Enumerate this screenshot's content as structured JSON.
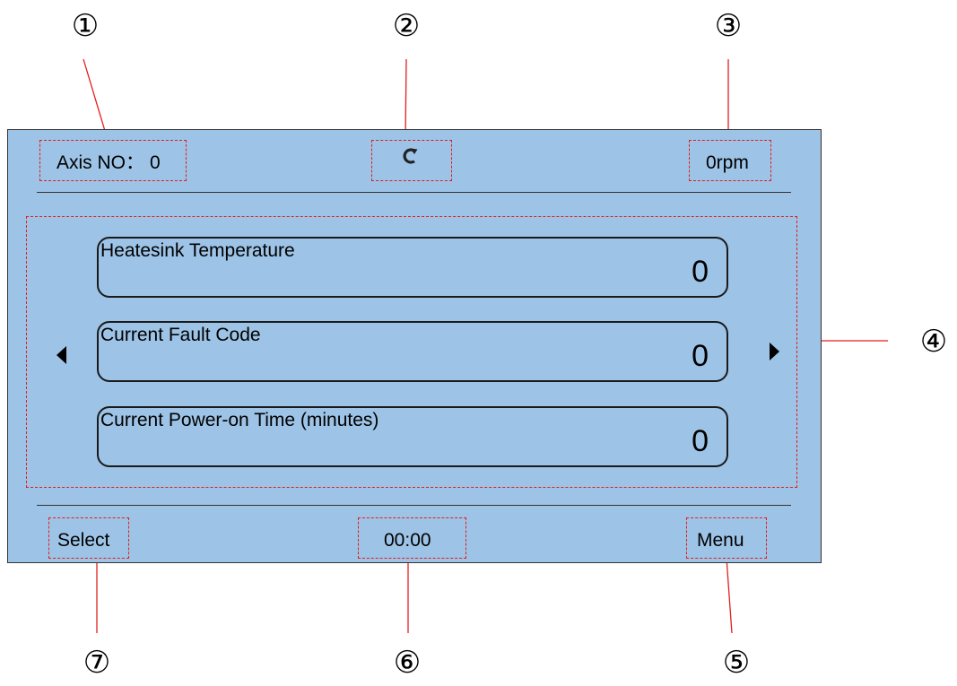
{
  "callouts": {
    "c1": "①",
    "c2": "②",
    "c3": "③",
    "c4": "④",
    "c5": "⑤",
    "c6": "⑥",
    "c7": "⑦"
  },
  "header": {
    "axis_label": "Axis NO：",
    "axis_value": "0",
    "refresh_icon": "refresh-icon",
    "speed": "0rpm"
  },
  "parameters": [
    {
      "label": "Heatesink Temperature",
      "value": "0"
    },
    {
      "label": "Current Fault Code",
      "value": "0"
    },
    {
      "label": "Current Power-on Time (minutes)",
      "value": "0"
    }
  ],
  "footer": {
    "select_label": "Select",
    "time": "00:00",
    "menu_label": "Menu"
  },
  "colors": {
    "panel_bg": "#9dc3e6",
    "callout_line": "#e41e1e"
  }
}
